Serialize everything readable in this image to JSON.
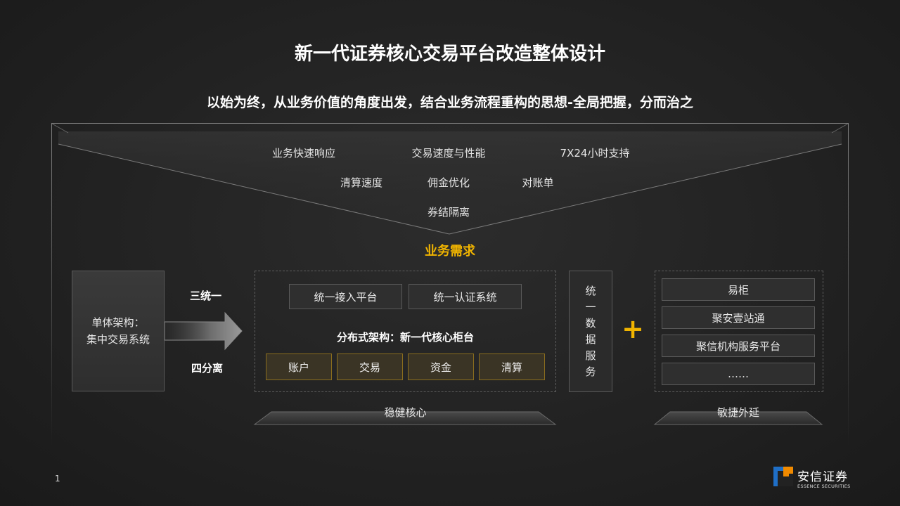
{
  "slide": {
    "title": "新一代证券核心交易平台改造整体设计",
    "subtitle": "以始为终，从业务价值的角度出发，结合业务流程重构的思想-全局把握，分而治之",
    "page_number": "1"
  },
  "requirements": {
    "items": [
      "业务快速响应",
      "交易速度与性能",
      "7X24小时支持",
      "清算速度",
      "佣金优化",
      "对账单",
      "券结隔离"
    ],
    "title": "业务需求"
  },
  "legacy": {
    "line1": "单体架构：",
    "line2": "集中交易系统",
    "arrow_top_label": "三统一",
    "arrow_bottom_label": "四分离"
  },
  "core": {
    "platforms": [
      "统一接入平台",
      "统一认证系统"
    ],
    "distributed_label": "分布式架构：新一代核心柜台",
    "modules": [
      "账户",
      "交易",
      "资金",
      "清算"
    ],
    "base_label": "稳健核心"
  },
  "unified_data": {
    "chars": [
      "统",
      "一",
      "数",
      "据",
      "服",
      "务"
    ]
  },
  "extension": {
    "items": [
      "易柜",
      "聚安壹站通",
      "聚信机构服务平台",
      "……"
    ],
    "base_label": "敏捷外延"
  },
  "logo": {
    "cn": "安信证券",
    "en": "ESSENCE SECURITIES"
  },
  "colors": {
    "accent": "#f0b400",
    "background": "#262626",
    "gold_border": "#8a6d1e"
  }
}
